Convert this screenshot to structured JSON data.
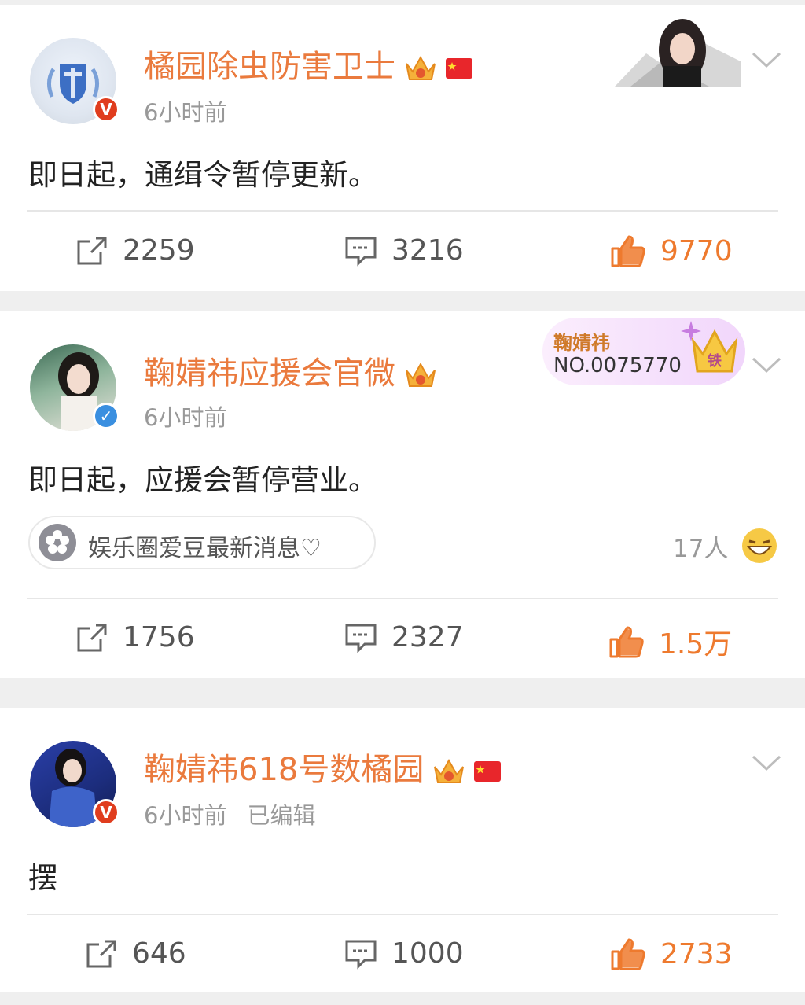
{
  "posts": [
    {
      "author": "橘园除虫防害卫士",
      "time": "6小时前",
      "edited": "",
      "text": "即日起，通缉令暂停更新。",
      "reposts": "2259",
      "comments": "3216",
      "likes": "9770"
    },
    {
      "author": "鞠婧祎应援会官微",
      "time": "6小时前",
      "edited": "",
      "text": "即日起，应援会暂停营业。",
      "fan_badge": {
        "name": "鞠婧祎",
        "number": "NO.0075770",
        "level": "铁"
      },
      "supertopic": "娱乐圈爱豆最新消息♡",
      "reactions": "17人",
      "reposts": "1756",
      "comments": "2327",
      "likes": "1.5万"
    },
    {
      "author": "鞠婧祎618号数橘园",
      "time": "6小时前",
      "edited": "已编辑",
      "text": "摆",
      "reposts": "646",
      "comments": "1000",
      "likes": "2733"
    }
  ],
  "colors": {
    "author": "#ea7a3d",
    "like": "#ee7a2e",
    "verified_orange": "#e03d1e",
    "verified_blue": "#3a8fe0"
  },
  "icons": [
    "repost-icon",
    "comment-icon",
    "like-icon",
    "chevron-down-icon",
    "crown-icon",
    "flag-icon"
  ]
}
